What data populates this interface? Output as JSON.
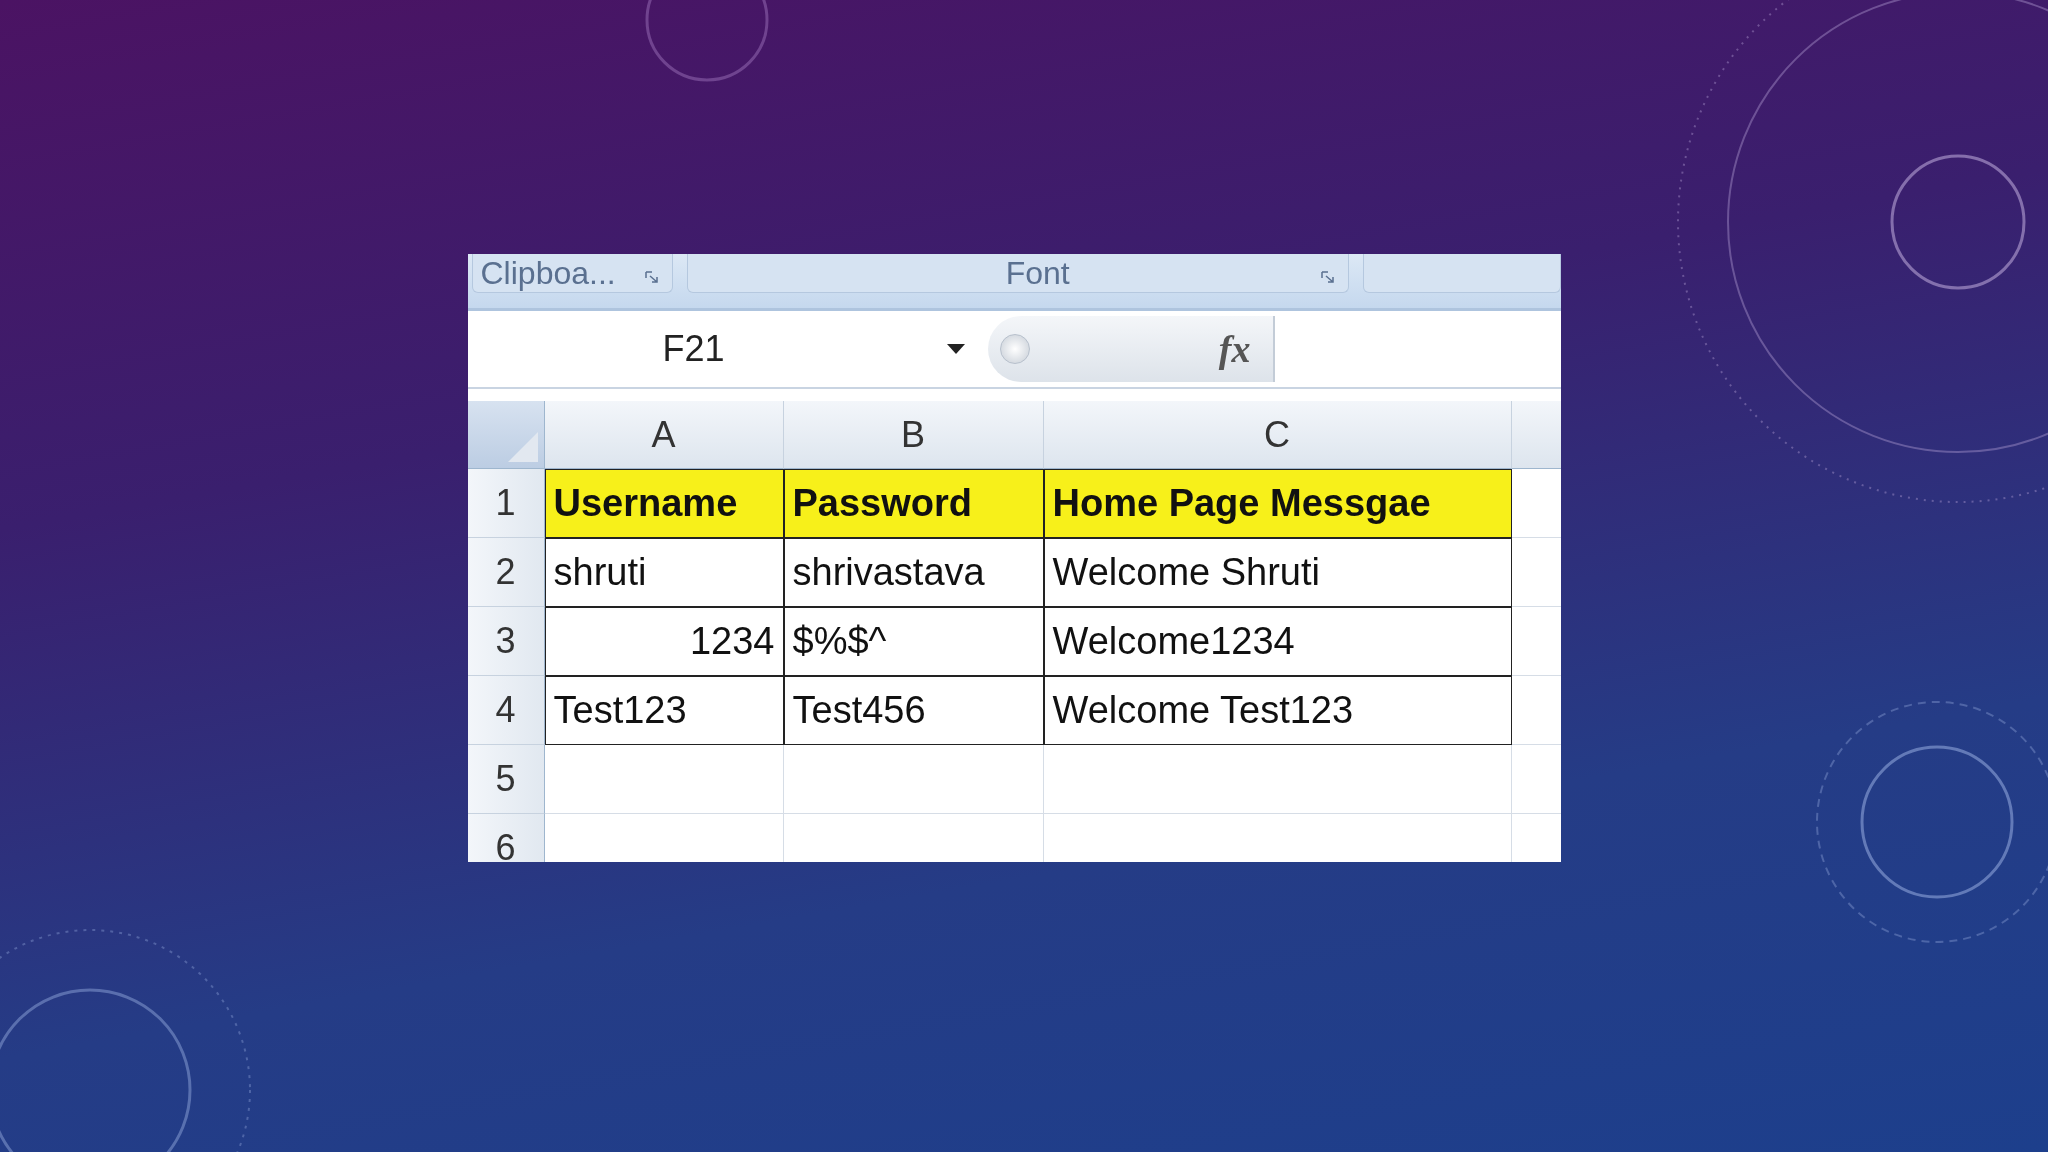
{
  "ribbon": {
    "groups": [
      {
        "label": "Clipboa..."
      },
      {
        "label": "Font"
      }
    ]
  },
  "formula_bar": {
    "name_box": "F21",
    "function_label": "fx"
  },
  "sheet": {
    "columns": [
      "A",
      "B",
      "C"
    ],
    "rows": [
      {
        "number": "1",
        "kind": "header",
        "cells": [
          {
            "text": "Username",
            "kind": "text"
          },
          {
            "text": "Password",
            "kind": "text"
          },
          {
            "text": "Home Page Messgae",
            "kind": "text"
          }
        ]
      },
      {
        "number": "2",
        "kind": "data",
        "cells": [
          {
            "text": "shruti",
            "kind": "text"
          },
          {
            "text": "shrivastava",
            "kind": "text"
          },
          {
            "text": "Welcome Shruti",
            "kind": "text"
          }
        ]
      },
      {
        "number": "3",
        "kind": "data",
        "cells": [
          {
            "text": "1234",
            "kind": "number"
          },
          {
            "text": "$%$^",
            "kind": "text"
          },
          {
            "text": "Welcome1234",
            "kind": "text"
          }
        ]
      },
      {
        "number": "4",
        "kind": "data",
        "cells": [
          {
            "text": "Test123",
            "kind": "text"
          },
          {
            "text": "Test456",
            "kind": "text"
          },
          {
            "text": "Welcome Test123",
            "kind": "text"
          }
        ]
      },
      {
        "number": "5",
        "kind": "empty",
        "cells": []
      },
      {
        "number": "6",
        "kind": "empty",
        "cells": []
      }
    ]
  }
}
